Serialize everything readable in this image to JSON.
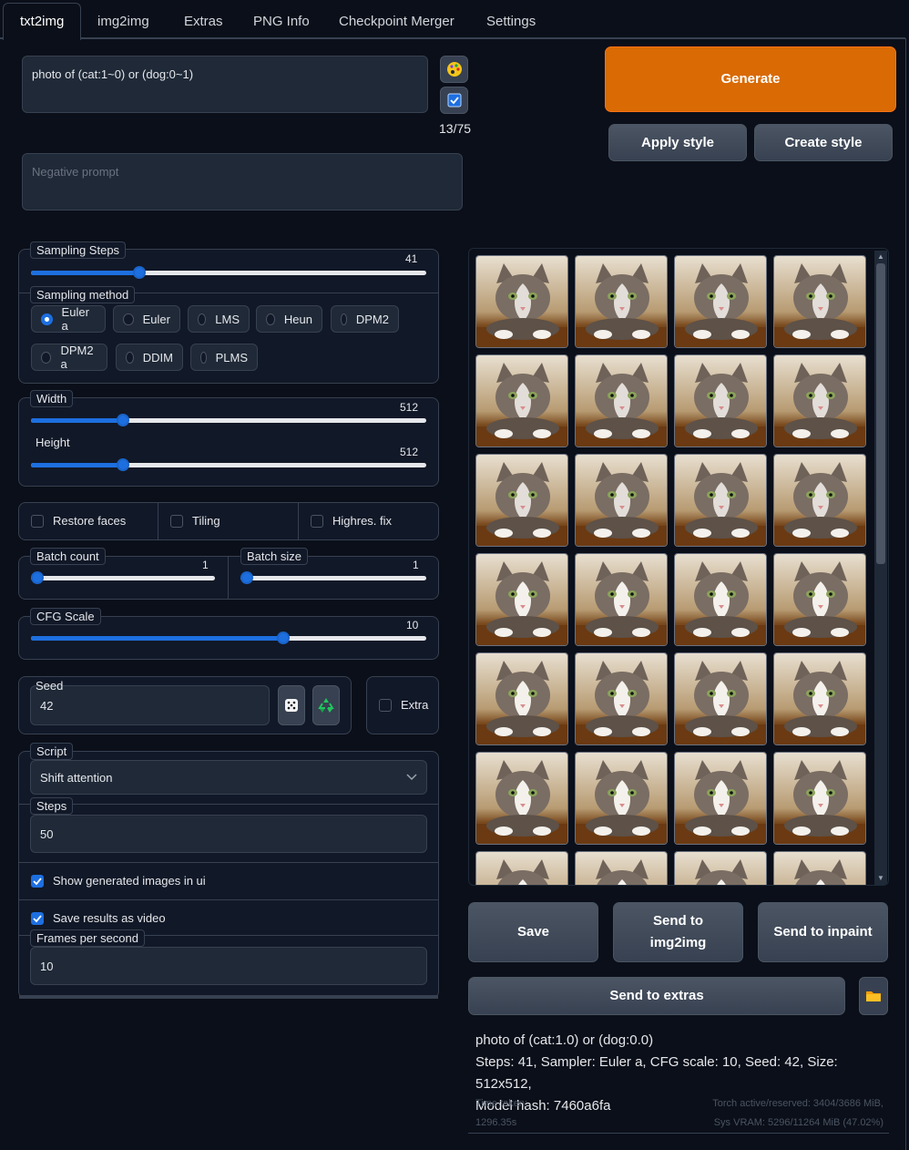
{
  "tabs": [
    {
      "label": "txt2img",
      "active": true
    },
    {
      "label": "img2img"
    },
    {
      "label": "Extras"
    },
    {
      "label": "PNG Info"
    },
    {
      "label": "Checkpoint Merger"
    },
    {
      "label": "Settings"
    }
  ],
  "prompt": {
    "value": "photo of (cat:1~0) or (dog:0~1)",
    "token_count": "13/75",
    "negative_placeholder": "Negative prompt"
  },
  "buttons": {
    "generate": "Generate",
    "apply_style": "Apply style",
    "create_style": "Create style",
    "save": "Save",
    "send_img2img": "Send to img2img",
    "send_inpaint": "Send to inpaint",
    "send_extras": "Send to extras"
  },
  "sampling_steps": {
    "label": "Sampling Steps",
    "value": "41",
    "fraction": 0.27
  },
  "sampling_method": {
    "label": "Sampling method",
    "options": [
      "Euler a",
      "Euler",
      "LMS",
      "Heun",
      "DPM2",
      "DPM2 a",
      "DDIM",
      "PLMS"
    ],
    "selected": "Euler a"
  },
  "width": {
    "label": "Width",
    "value": "512",
    "fraction": 0.23
  },
  "height": {
    "label": "Height",
    "value": "512",
    "fraction": 0.23
  },
  "checkboxes": {
    "restore_faces": "Restore faces",
    "tiling": "Tiling",
    "highres_fix": "Highres. fix"
  },
  "batch_count": {
    "label": "Batch count",
    "value": "1",
    "fraction": 0.0
  },
  "batch_size": {
    "label": "Batch size",
    "value": "1",
    "fraction": 0.0
  },
  "cfg_scale": {
    "label": "CFG Scale",
    "value": "10",
    "fraction": 0.6
  },
  "seed": {
    "label": "Seed",
    "value": "42",
    "extra_label": "Extra"
  },
  "script": {
    "label": "Script",
    "selected": "Shift attention",
    "steps_label": "Steps",
    "steps_value": "50",
    "show_images_label": "Show generated images in ui",
    "save_video_label": "Save results as video",
    "fps_label": "Frames per second",
    "fps_value": "10"
  },
  "gallery": {
    "rows_visible": 7,
    "cols": 4,
    "icon": "cat-photo-thumbnail"
  },
  "output_info": {
    "line1": "photo of (cat:1.0) or (dog:0.0)",
    "line2": "Steps: 41, Sampler: Euler a, CFG scale: 10, Seed: 42, Size: 512x512,",
    "line3": "Model hash: 7460a6fa",
    "time_label": "Time taken:",
    "time_value": "1296.35s",
    "torch_mem": "Torch active/reserved: 3404/3686 MiB,",
    "vram": "Sys VRAM: 5296/11264 MiB (47.02%)"
  },
  "colors": {
    "accent": "#1d6fe0",
    "generate": "#d96a04",
    "background": "#0b0f19",
    "panel": "#111827"
  }
}
